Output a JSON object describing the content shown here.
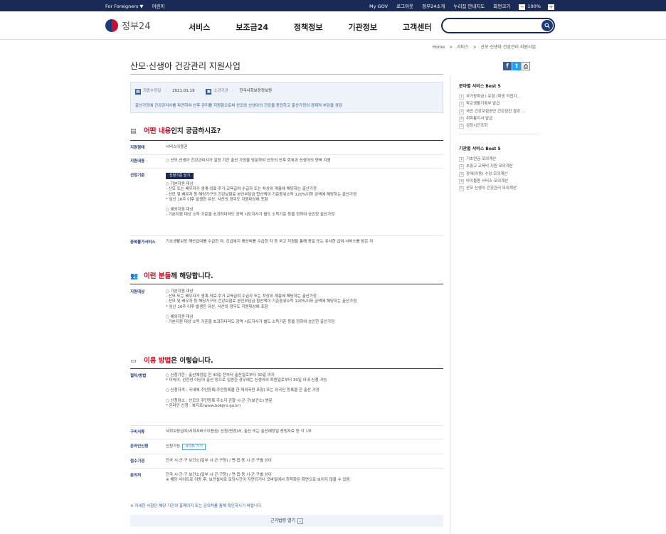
{
  "topbar": {
    "left": [
      "For Foreigners ▼",
      "어린이"
    ],
    "right": [
      "My GOV",
      "로그아웃",
      "정부24소개",
      "누리집 안내지도",
      "화면크기"
    ],
    "zoom_minus": "−",
    "zoom_value": "100%",
    "zoom_plus": "+"
  },
  "header": {
    "logo_text": "정부24",
    "nav": [
      "서비스",
      "보조금24",
      "정책정보",
      "기관정보",
      "고객센터"
    ],
    "search_placeholder": ""
  },
  "breadcrumb": [
    "Home",
    ">",
    "서비스",
    ">",
    "산모·신생아 건강관리 지원사업"
  ],
  "page_title": "산모·신생아 건강관리 지원사업",
  "share": {
    "facebook": "f",
    "twitter": "t",
    "print": "⎙"
  },
  "info": {
    "updated_label": "최종수정일",
    "updated_value": "2021.01.19",
    "org_label": "소관기관",
    "org_value": "한국사회보장정보원",
    "description": "출산가정에 건강관리사를 파견하여 산후 관리를 지원함으로써 산모와 신생아의 건강을 증진하고 출산가정의 경제적 부담을 경감"
  },
  "section1": {
    "prefix": "",
    "highlight": "어떤 내용",
    "suffix": "인지 궁금하시죠?",
    "rows": {
      "support_type": {
        "label": "지원형태",
        "value": "서비스이용권"
      },
      "support_content": {
        "label": "지원내용",
        "value": "○ 산모·신생아 건강관리사가 일정 기간 출산 가정을 방문하여 산모의 산후 회복과 신생아의 양육 지원"
      },
      "criteria": {
        "label": "선정기준",
        "button": "선정기준 닫기",
        "lines1": [
          "○ 기본지원 대상",
          "- 산모 또는 배우자가 생계·의료·주거·교육급여 수급자 또는 차상위 계층에 해당하는 출산가정",
          "- 산모 및 배우자 등 해당가구의 건강보험료 본인부담금 합산액이 기준중위소득 120%이하 금액에 해당하는 출산가정",
          " * 임신 16주 이후 발생한 유산, 사산의 경우도 지원대상에 포함"
        ],
        "lines2": [
          "○ 예외지원 대상",
          "- 기본지원 대상 소득 기준을 초과하더라도 광역 시도지사가 별도 소득기준 등을 정하여 승인한 출산가정"
        ]
      },
      "duplicate": {
        "label": "중복불가서비스",
        "value": "기초생활보장 해산급여를 수급한 자, 긴급복지 해산비를 수급한 자 등 국고 지원을 통해 동일 또는 유사한 급여·서비스를 받은 자"
      }
    }
  },
  "section2": {
    "highlight": "이런 분들",
    "suffix": "께 해당합니다.",
    "target": {
      "label": "지원대상",
      "lines1": [
        "○ 기본지원 대상",
        "- 산모 또는 배우자가 생계·의료·주거·교육급여 수급자 또는 차상위 계층에 해당하는 출산가정",
        "- 산모 및 배우자 등 해당가구의 건강보험료 본인부담금 합산액이 기준중위소득 120%이하 금액에 해당하는 출산가정",
        " * 임신 16주 이후 발생한 유산, 사산의 경우도 지원대상에 포함"
      ],
      "lines2": [
        "○ 예외지원 대상",
        "- 기본지원 대상 소득 기준을 초과하더라도 광역 시도지사가 별도 소득기준 등을 정하여 승인한 출산가정"
      ]
    }
  },
  "section3": {
    "highlight": "이용 방법",
    "suffix": "은 이렇습니다.",
    "procedure": {
      "label": "절차/방법",
      "g1": [
        "○ 신청기한 : 출산예정일 전 40일 전부터 출산일로부터 30일 까지",
        "  * 미숙아, 선천성 이상아 출산 등으로 입원한 경우에는 신생아의 퇴원일로부터 30일 이내 신청 가능"
      ],
      "g2": [
        "○ 신청자격 : 국내에 주민등록(주민등록을 한 재외국민 포함) 또는 외국인 등록을 한 출산 가정"
      ],
      "g3": [
        "○ 신청장소 : 산모의 주민등록 주소지 관할 시·군·구(보건소) 방문",
        "  * 온라인 신청 : 복지로(www.bokjiro.go.kr)"
      ]
    },
    "documents": {
      "label": "구비서류",
      "value": "사회보장급여(사회서비스이용권) 신청(변경)서, 출산 또는 출산예정일 증빙자료 등 각 1부"
    },
    "online": {
      "label": "온라인신청",
      "value": "신청가능",
      "button": "사이트 가기"
    },
    "office": {
      "label": "접수기관",
      "value": "전국 시·군·구 보건소(일부 시·군·구청) / 면·읍·동 시·군·구별 상이"
    },
    "inquiry": {
      "label": "문의처",
      "lines": [
        "전국 시·군·구 보건소(일부 시·군·구청) / 면·읍·동 시·군·구별 상이",
        "※ 해당 사이트로 이동 후, 보안설치로 로딩시간이 지연되거나 모바일에서 최적화된 화면으로 보이지 않을 수 있음"
      ]
    }
  },
  "bottom_note": "※ 자세한 사항은 해당 기관의 홈페이지 또는 문의처를 통해 확인하시기 바랍니다.",
  "law_button": "근거법령 열기",
  "sidebar": {
    "field_title": "분야별 서비스 Best 5",
    "field_items": [
      {
        "n": "1",
        "label": "국가장학금 Ⅰ 유형 (학생 직접지..."
      },
      {
        "n": "2",
        "label": "학교생활기록부 발급"
      },
      {
        "n": "3",
        "label": "국민 건강보험공단 건강검진 결과 ..."
      },
      {
        "n": "4",
        "label": "취학통지서 발급"
      },
      {
        "n": "5",
        "label": "검정시간조회"
      }
    ],
    "org_title": "기관별 서비스 Best 5",
    "org_items": [
      {
        "n": "1",
        "label": "기초연금 모의계산"
      },
      {
        "n": "2",
        "label": "초중고 교육비 지원 모의계산"
      },
      {
        "n": "3",
        "label": "장애(아동) 수당 모의계산"
      },
      {
        "n": "4",
        "label": "아이돌봄 서비스 모의계산"
      },
      {
        "n": "5",
        "label": "산모 신생아 건강관리 모의계산"
      }
    ]
  }
}
